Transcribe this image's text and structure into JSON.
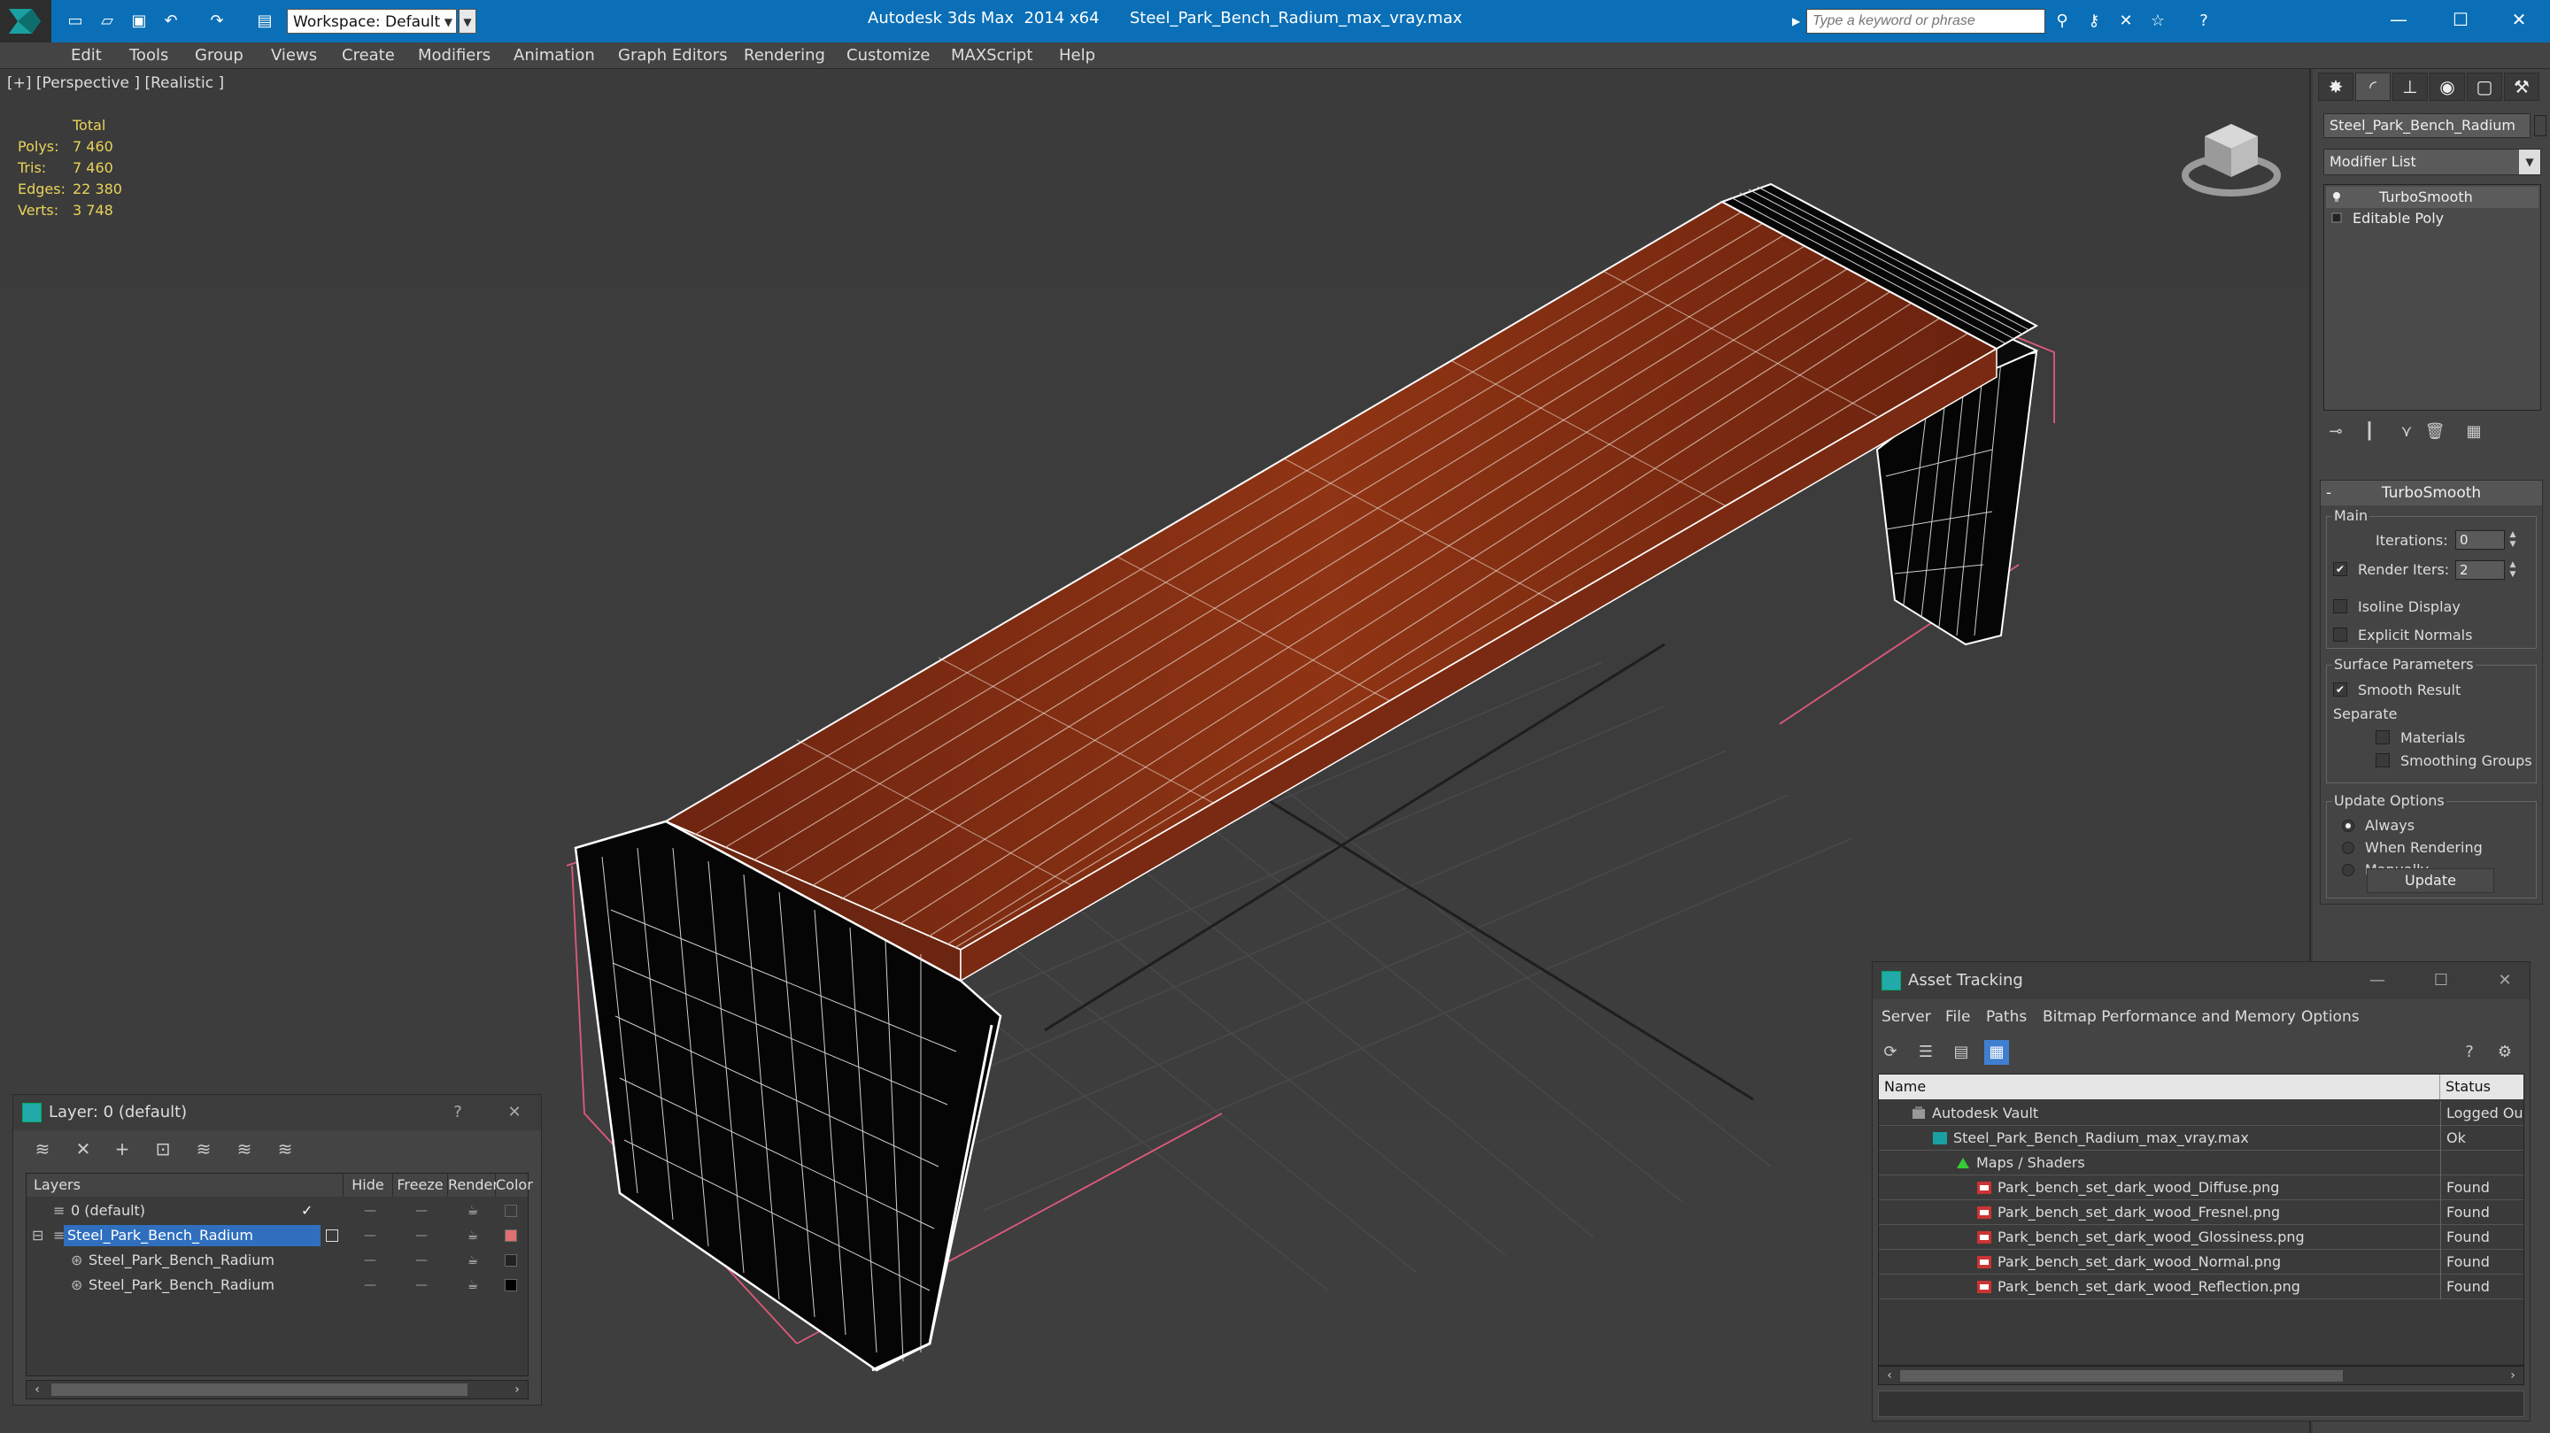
{
  "titlebar": {
    "workspace_label": "Workspace: Default",
    "title": "Autodesk 3ds Max  2014 x64      Steel_Park_Bench_Radium_max_vray.max",
    "search_placeholder": "Type a keyword or phrase"
  },
  "menu": [
    "Edit",
    "Tools",
    "Group",
    "Views",
    "Create",
    "Modifiers",
    "Animation",
    "Graph Editors",
    "Rendering",
    "Customize",
    "MAXScript",
    "Help"
  ],
  "viewport": {
    "label": "[+] [Perspective ] [Realistic ]",
    "stats": {
      "total_label": "Total",
      "rows": [
        {
          "key": "Polys:",
          "value": "7 460"
        },
        {
          "key": "Tris:",
          "value": "7 460"
        },
        {
          "key": "Edges:",
          "value": "22 380"
        },
        {
          "key": "Verts:",
          "value": "3 748"
        }
      ]
    }
  },
  "command_panel": {
    "object_name": "Steel_Park_Bench_Radium",
    "modifier_list": "Modifier List",
    "stack": [
      "TurboSmooth",
      "Editable Poly"
    ],
    "turbosmooth": {
      "title": "TurboSmooth",
      "main_group": "Main",
      "iterations_label": "Iterations:",
      "iterations_value": "0",
      "render_iters_label": "Render Iters:",
      "render_iters_value": "2",
      "isoline_label": "Isoline Display",
      "explicit_normals_label": "Explicit Normals",
      "surface_group": "Surface Parameters",
      "smooth_result_label": "Smooth Result",
      "separate_label": "Separate",
      "materials_label": "Materials",
      "smoothing_groups_label": "Smoothing Groups",
      "update_group": "Update Options",
      "always_label": "Always",
      "when_rendering_label": "When Rendering",
      "manually_label": "Manually",
      "update_button": "Update"
    }
  },
  "layer_dialog": {
    "title": "Layer: 0 (default)",
    "help": "?",
    "columns": [
      "Layers",
      "Hide",
      "Freeze",
      "Render",
      "Color"
    ],
    "rows": [
      {
        "name": "0 (default)",
        "color": "#3a3a3a"
      },
      {
        "name": "Steel_Park_Bench_Radium",
        "color": "#e07070"
      },
      {
        "name": "Steel_Park_Bench_Radium",
        "color": "#222222"
      },
      {
        "name": "Steel_Park_Bench_Radium",
        "color": "#000000"
      }
    ]
  },
  "asset_tracking": {
    "title": "Asset Tracking",
    "menu": [
      "Server",
      "File",
      "Paths",
      "Bitmap Performance and Memory",
      "Options"
    ],
    "columns": [
      "Name",
      "Status"
    ],
    "rows": [
      {
        "name": "Autodesk Vault",
        "status": "Logged Ou"
      },
      {
        "name": "Steel_Park_Bench_Radium_max_vray.max",
        "status": "Ok"
      },
      {
        "name": "Maps / Shaders",
        "status": ""
      },
      {
        "name": "Park_bench_set_dark_wood_Diffuse.png",
        "status": "Found"
      },
      {
        "name": "Park_bench_set_dark_wood_Fresnel.png",
        "status": "Found"
      },
      {
        "name": "Park_bench_set_dark_wood_Glossiness.png",
        "status": "Found"
      },
      {
        "name": "Park_bench_set_dark_wood_Normal.png",
        "status": "Found"
      },
      {
        "name": "Park_bench_set_dark_wood_Reflection.png",
        "status": "Found"
      }
    ]
  },
  "colors": {
    "titlebar": "#0a6fb6",
    "wood": "#8a2e12",
    "selection": "#2f6fbe",
    "stats_text": "#e8d35a"
  },
  "icons": {
    "quick_access": [
      "new-file-icon",
      "open-file-icon",
      "save-icon",
      "undo-icon",
      "redo-icon",
      "project-folder-icon"
    ],
    "infocenter": [
      "binoculars-icon",
      "key-icon",
      "exchange-icon",
      "star-icon",
      "help-icon"
    ],
    "command_tabs": [
      "create-icon",
      "modify-icon",
      "hierarchy-icon",
      "motion-icon",
      "display-icon",
      "utilities-icon"
    ]
  }
}
